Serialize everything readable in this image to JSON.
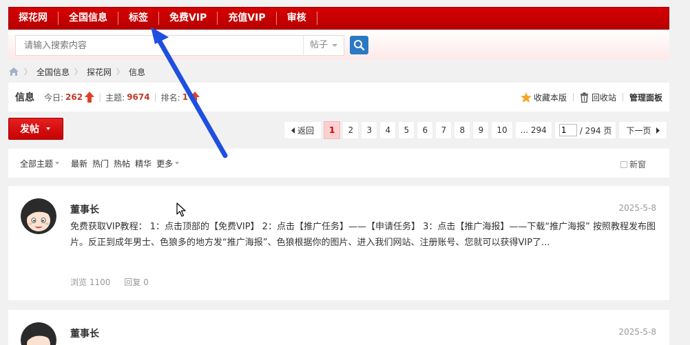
{
  "topnav": {
    "items": [
      {
        "label": "探花网"
      },
      {
        "label": "全国信息"
      },
      {
        "label": "标签"
      },
      {
        "label": "免费VIP"
      },
      {
        "label": "充值VIP"
      },
      {
        "label": "审核"
      }
    ]
  },
  "search": {
    "placeholder": "请输入搜索内容",
    "type_label": "帖子",
    "button_icon": "search-icon"
  },
  "breadcrumb": {
    "home_icon": "home-icon",
    "items": [
      "全国信息",
      "探花网",
      "信息"
    ]
  },
  "forum": {
    "title": "信息",
    "today_label": "今日:",
    "today_value": "262",
    "topics_label": "主题:",
    "topics_value": "9674",
    "rank_label": "排名:",
    "rank_value": "1",
    "favorite_label": "收藏本版",
    "recycle_label": "回收站",
    "manage_label": "管理面板"
  },
  "post_button": {
    "label": "发帖"
  },
  "pagination": {
    "prev_label": "返回",
    "pages": [
      "1",
      "2",
      "3",
      "4",
      "5",
      "6",
      "7",
      "8",
      "9",
      "10",
      "... 294"
    ],
    "current_page": "1",
    "input_value": "1",
    "total_label": "/ 294 页",
    "next_label": "下一页"
  },
  "filters": {
    "items": [
      {
        "label": "全部主题",
        "dropdown": true
      },
      {
        "label": "最新",
        "dropdown": false
      },
      {
        "label": "热门",
        "dropdown": false
      },
      {
        "label": "热帖",
        "dropdown": false
      },
      {
        "label": "精华",
        "dropdown": false
      },
      {
        "label": "更多",
        "dropdown": true
      }
    ],
    "new_window_label": "新窗"
  },
  "threads": [
    {
      "author": "董事长",
      "date": "2025-5-8",
      "excerpt": "免费获取VIP教程：  1：点击顶部的【免费VIP】 2：点击【推广任务】——【申请任务】 3：点击【推广海报】——下载“推广海报” 按照教程发布图片。反正到成年男士、色狼多的地方发“推广海报”、色狼根据你的图片、进入我们网站、注册账号、您就可以获得VIP了...",
      "views_label": "浏览",
      "views": "1100",
      "replies_label": "回复",
      "replies": "0"
    },
    {
      "author": "董事长",
      "date": "2025-5-8"
    }
  ],
  "colors": {
    "nav_red": "#c80000",
    "accent_blue": "#2a79c4",
    "annotation_arrow": "#1f4fe0"
  }
}
